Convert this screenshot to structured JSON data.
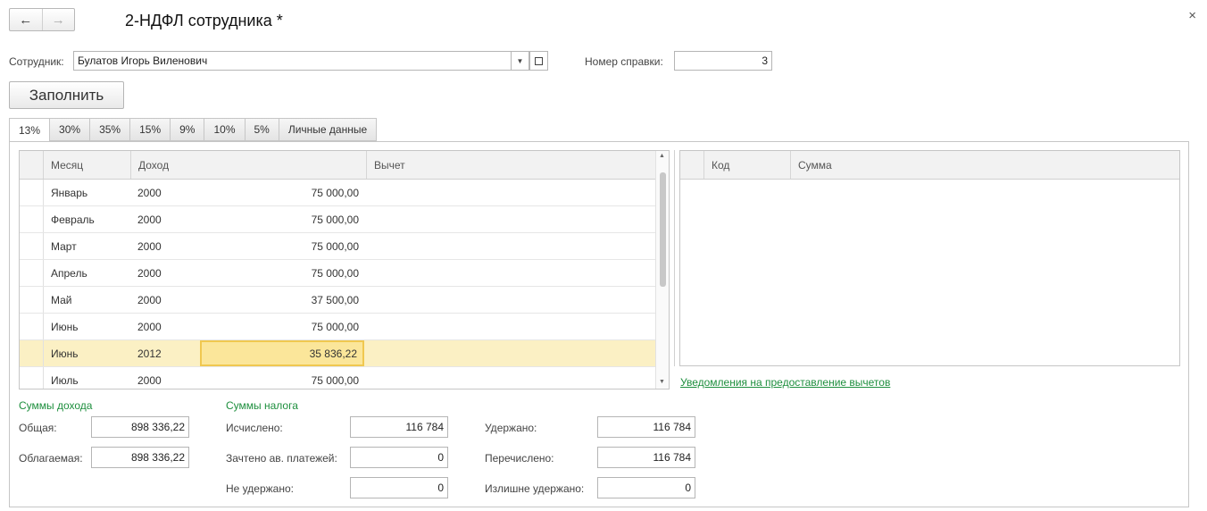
{
  "window": {
    "title": "2-НДФЛ сотрудника *"
  },
  "nav": {
    "back_icon": "←",
    "forward_icon": "→",
    "close_icon": "×"
  },
  "employee": {
    "label": "Сотрудник:",
    "value": "Булатов Игорь Виленович"
  },
  "certificate": {
    "label": "Номер справки:",
    "value": "3"
  },
  "fill_button": "Заполнить",
  "tabs": [
    "13%",
    "30%",
    "35%",
    "15%",
    "9%",
    "10%",
    "5%",
    "Личные данные"
  ],
  "income_table": {
    "columns": [
      "Месяц",
      "Доход",
      "Вычет"
    ],
    "rows": [
      {
        "month": "Январь",
        "year": "2000",
        "amount": "75 000,00"
      },
      {
        "month": "Февраль",
        "year": "2000",
        "amount": "75 000,00"
      },
      {
        "month": "Март",
        "year": "2000",
        "amount": "75 000,00"
      },
      {
        "month": "Апрель",
        "year": "2000",
        "amount": "75 000,00"
      },
      {
        "month": "Май",
        "year": "2000",
        "amount": "37 500,00"
      },
      {
        "month": "Июнь",
        "year": "2000",
        "amount": "75 000,00"
      },
      {
        "month": "Июнь",
        "year": "2012",
        "amount": "35 836,22"
      },
      {
        "month": "Июль",
        "year": "2000",
        "amount": "75 000,00"
      }
    ]
  },
  "deduction_table": {
    "columns": [
      "Код",
      "Сумма"
    ]
  },
  "notifications_link": "Уведомления на предоставление вычетов",
  "income_sums": {
    "title": "Суммы дохода",
    "total_label": "Общая:",
    "total": "898 336,22",
    "taxable_label": "Облагаемая:",
    "taxable": "898 336,22"
  },
  "tax_sums": {
    "title": "Суммы налога",
    "calculated_label": "Исчислено:",
    "calculated": "116 784",
    "advance_label": "Зачтено ав. платежей:",
    "advance": "0",
    "not_withheld_label": "Не удержано:",
    "not_withheld": "0",
    "withheld_label": "Удержано:",
    "withheld": "116 784",
    "transferred_label": "Перечислено:",
    "transferred": "116 784",
    "excess_label": "Излишне удержано:",
    "excess": "0"
  }
}
